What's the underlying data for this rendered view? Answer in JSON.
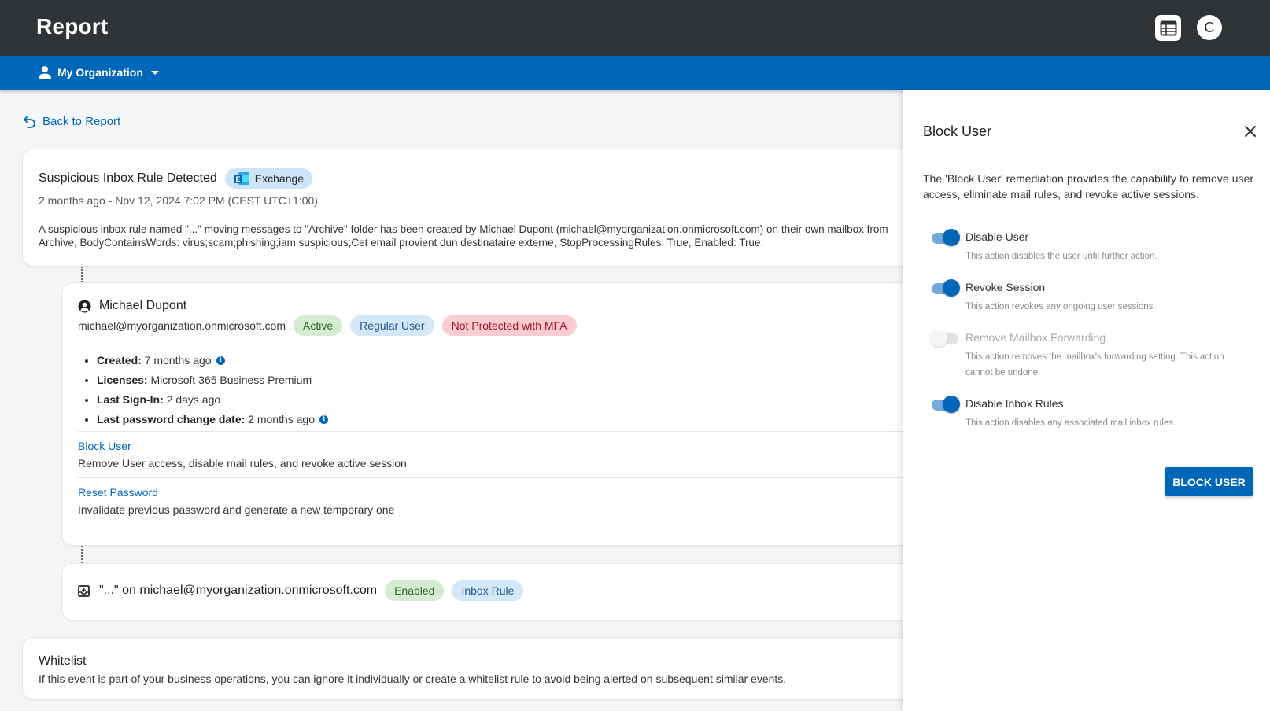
{
  "header": {
    "title": "Report",
    "avatar_letter": "C"
  },
  "org": {
    "label": "My Organization"
  },
  "back": {
    "label": "Back to Report"
  },
  "alert": {
    "title": "Suspicious Inbox Rule Detected",
    "source_chip": "Exchange",
    "time": "2 months ago - Nov 12, 2024 7:02 PM (CEST UTC+1:00)",
    "description_line1": "A suspicious inbox rule named \"...\" moving messages to \"Archive\" folder has been created by Michael Dupont (michael@myorganization.onmicrosoft.com) on their own mailbox from",
    "description_line2": "Archive, BodyContainsWords: virus;scam;phishing;iam suspicious;Cet email provient dun destinataire externe, StopProcessingRules: True, Enabled: True."
  },
  "user": {
    "name": "Michael Dupont",
    "email": "michael@myorganization.onmicrosoft.com",
    "chips": {
      "status": "Active",
      "type": "Regular User",
      "mfa": "Not Protected with MFA"
    },
    "details": [
      {
        "label": "Created:",
        "value": "7 months ago"
      },
      {
        "label": "Licenses:",
        "value": "Microsoft 365 Business Premium"
      },
      {
        "label": "Last Sign-In:",
        "value": "2 days ago"
      },
      {
        "label": "Last password change date:",
        "value": "2 months ago"
      }
    ],
    "actions": [
      {
        "label": "Block User",
        "desc": "Remove User access, disable mail rules, and revoke active session"
      },
      {
        "label": "Reset Password",
        "desc": "Invalidate previous password and generate a new temporary one"
      }
    ]
  },
  "rule": {
    "text": "\"...\" on michael@myorganization.onmicrosoft.com",
    "chip_status": "Enabled",
    "chip_type": "Inbox Rule"
  },
  "whitelist": {
    "title": "Whitelist",
    "desc": "If this event is part of your business operations, you can ignore it individually or create a whitelist rule to avoid being alerted on subsequent similar events."
  },
  "panel": {
    "title": "Block User",
    "desc": "The 'Block User' remediation provides the capability to remove user access, eliminate mail rules, and revoke active sessions.",
    "options": [
      {
        "label": "Disable User",
        "desc": "This action disables the user until further action.",
        "enabled": true
      },
      {
        "label": "Revoke Session",
        "desc": "This action revokes any ongoing user sessions.",
        "enabled": true
      },
      {
        "label": "Remove Mailbox Forwarding",
        "desc": "This action removes the mailbox's forwarding setting. This action cannot be undone.",
        "enabled": false
      },
      {
        "label": "Disable Inbox Rules",
        "desc": "This action disables any associated mail inbox rules.",
        "enabled": true
      }
    ],
    "button": "BLOCK USER"
  },
  "colors": {
    "topbar": "#2f3437",
    "brand_blue": "#0067b8",
    "active_green": "#d6ecd2",
    "mfa_red": "#f8ccd1"
  }
}
